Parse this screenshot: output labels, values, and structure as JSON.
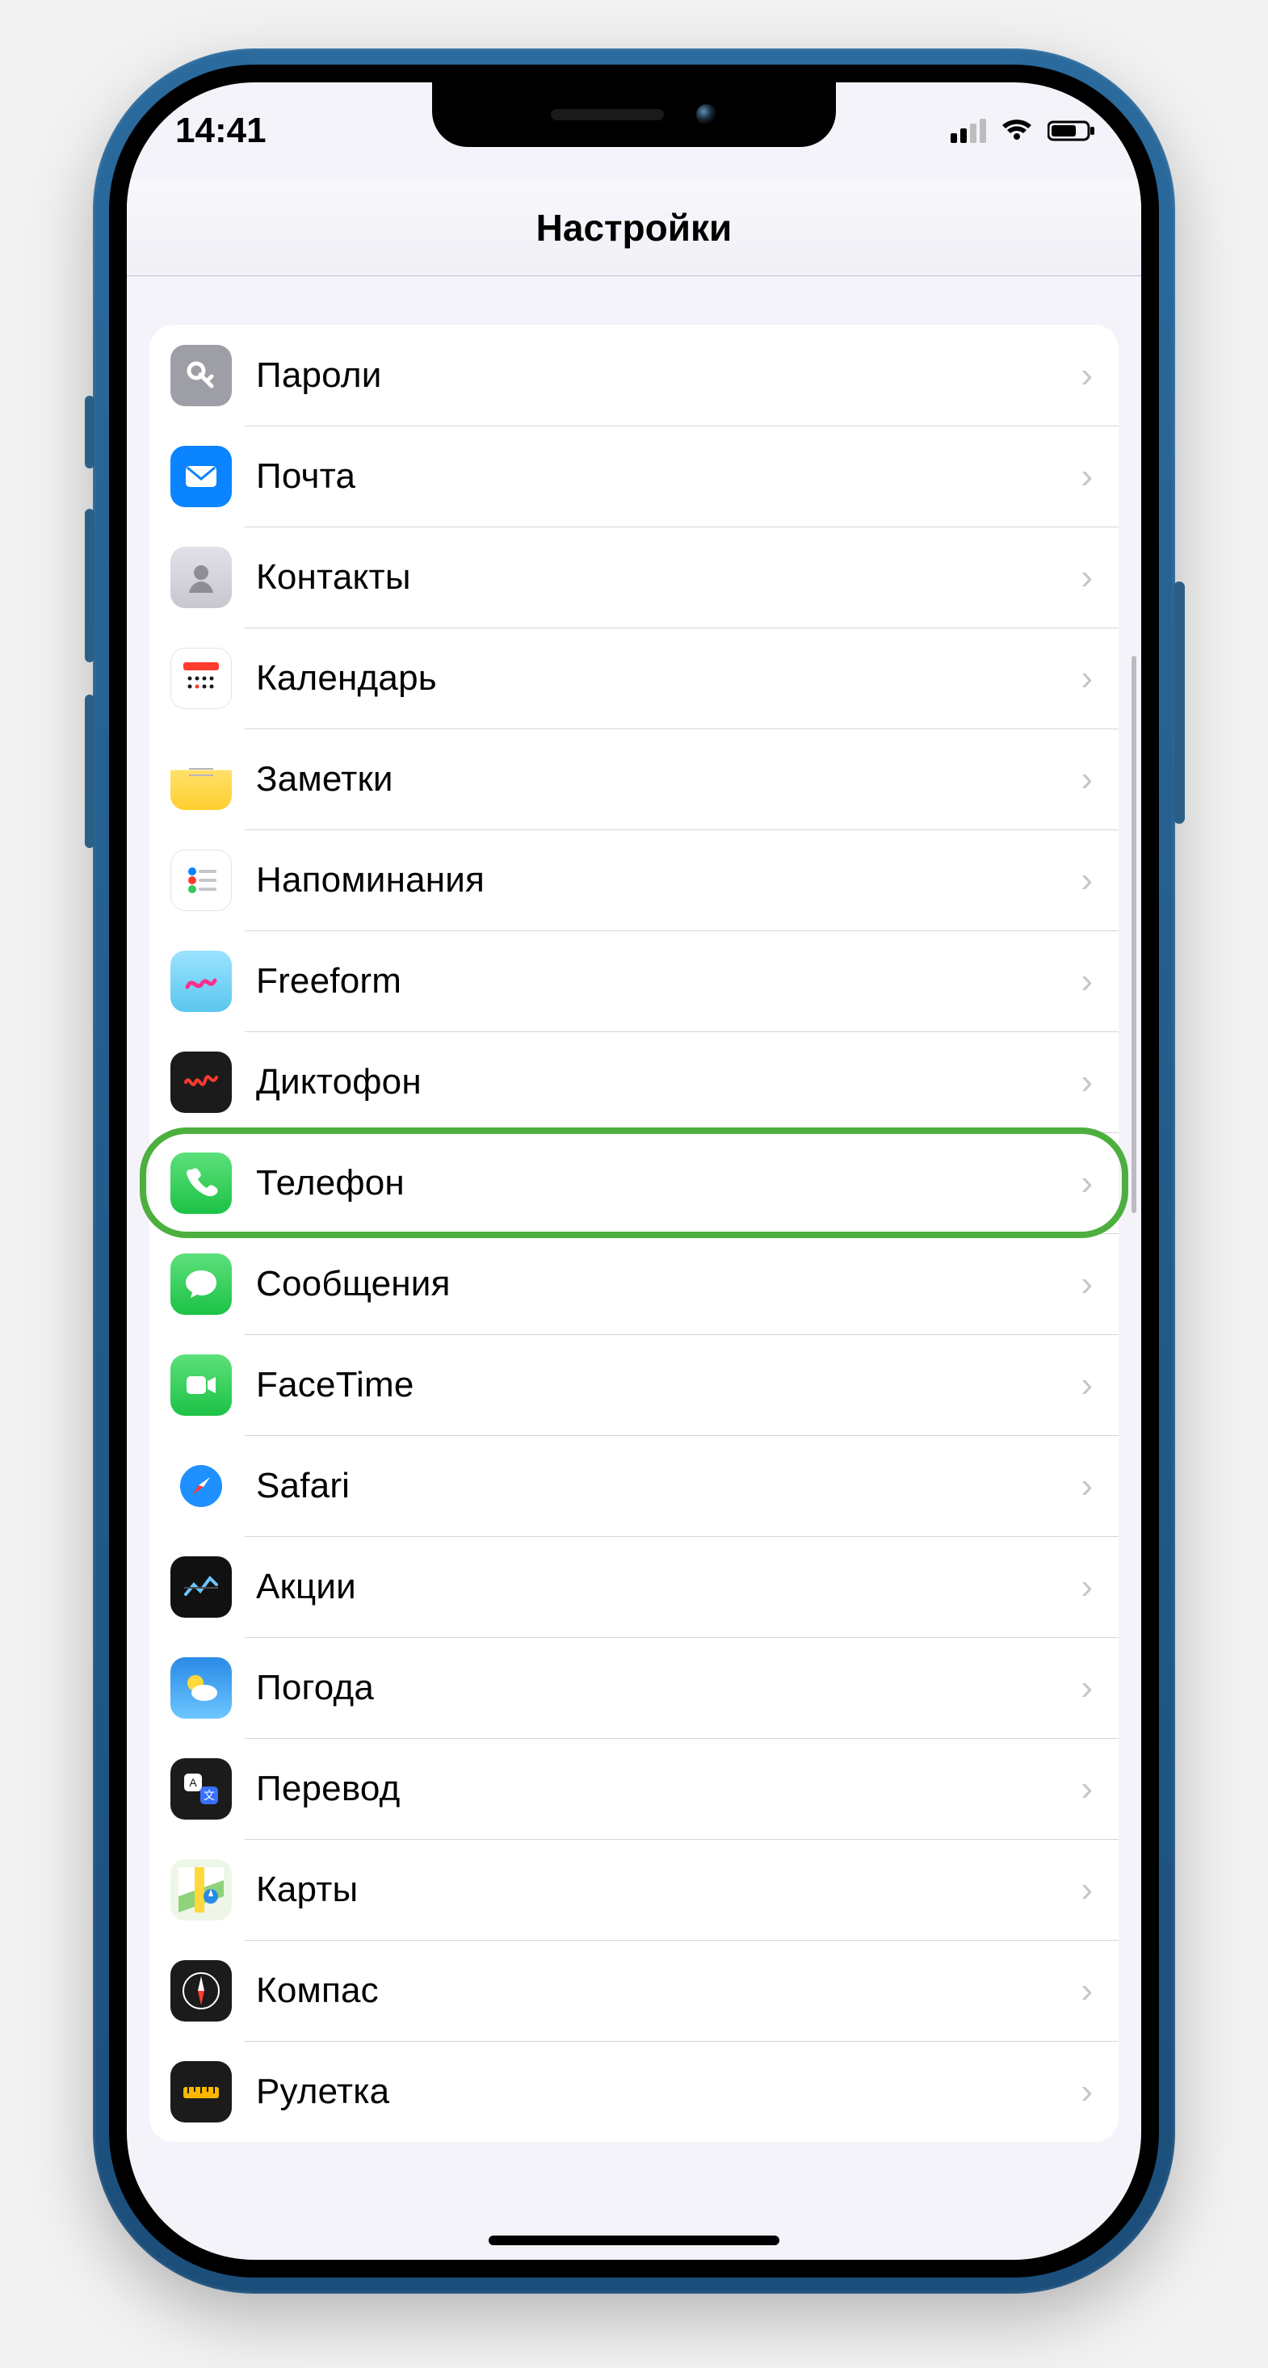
{
  "status": {
    "time": "14:41"
  },
  "header": {
    "title": "Настройки"
  },
  "highlighted_item_key": "phone",
  "settings_items": [
    {
      "key": "passwords",
      "label": "Пароли",
      "icon": "key-icon"
    },
    {
      "key": "mail",
      "label": "Почта",
      "icon": "mail-icon"
    },
    {
      "key": "contacts",
      "label": "Контакты",
      "icon": "contacts-icon"
    },
    {
      "key": "calendar",
      "label": "Календарь",
      "icon": "calendar-icon"
    },
    {
      "key": "notes",
      "label": "Заметки",
      "icon": "notes-icon"
    },
    {
      "key": "reminders",
      "label": "Напоминания",
      "icon": "reminders-icon"
    },
    {
      "key": "freeform",
      "label": "Freeform",
      "icon": "freeform-icon"
    },
    {
      "key": "voicememo",
      "label": "Диктофон",
      "icon": "voicememo-icon"
    },
    {
      "key": "phone",
      "label": "Телефон",
      "icon": "phone-icon"
    },
    {
      "key": "messages",
      "label": "Сообщения",
      "icon": "messages-icon"
    },
    {
      "key": "facetime",
      "label": "FaceTime",
      "icon": "facetime-icon"
    },
    {
      "key": "safari",
      "label": "Safari",
      "icon": "safari-icon"
    },
    {
      "key": "stocks",
      "label": "Акции",
      "icon": "stocks-icon"
    },
    {
      "key": "weather",
      "label": "Погода",
      "icon": "weather-icon"
    },
    {
      "key": "translate",
      "label": "Перевод",
      "icon": "translate-icon"
    },
    {
      "key": "maps",
      "label": "Карты",
      "icon": "maps-icon"
    },
    {
      "key": "compass",
      "label": "Компас",
      "icon": "compass-icon"
    },
    {
      "key": "measure",
      "label": "Рулетка",
      "icon": "measure-icon"
    }
  ]
}
